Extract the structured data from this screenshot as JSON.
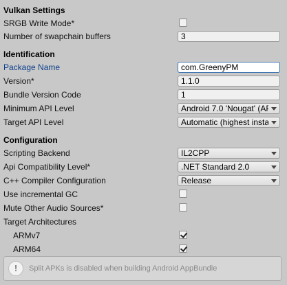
{
  "vulkan": {
    "header": "Vulkan Settings",
    "srgb_label": "SRGB Write Mode*",
    "srgb_checked": false,
    "swapchain_label": "Number of swapchain buffers",
    "swapchain_value": "3"
  },
  "identification": {
    "header": "Identification",
    "package_name_label": "Package Name",
    "package_name_value": "com.GreenyPM",
    "version_label": "Version*",
    "version_value": "1.1.0",
    "bundle_label": "Bundle Version Code",
    "bundle_value": "1",
    "min_api_label": "Minimum API Level",
    "min_api_value": "Android 7.0 'Nougat' (AP",
    "target_api_label": "Target API Level",
    "target_api_value": "Automatic (highest insta"
  },
  "configuration": {
    "header": "Configuration",
    "scripting_label": "Scripting Backend",
    "scripting_value": "IL2CPP",
    "api_compat_label": "Api Compatibility Level*",
    "api_compat_value": ".NET Standard 2.0",
    "cpp_label": "C++ Compiler Configuration",
    "cpp_value": "Release",
    "incremental_gc_label": "Use incremental GC",
    "incremental_gc_checked": false,
    "mute_audio_label": "Mute Other Audio Sources*",
    "mute_audio_checked": false,
    "target_arch_label": "Target Architectures",
    "armv7_label": "ARMv7",
    "armv7_checked": true,
    "arm64_label": "ARM64",
    "arm64_checked": true
  },
  "help": {
    "icon": "info-icon",
    "text": "Split APKs is disabled when building Android AppBundle"
  }
}
